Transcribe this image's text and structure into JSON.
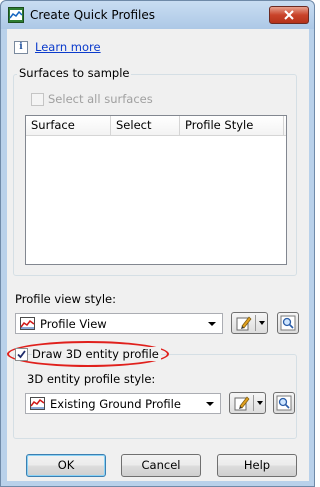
{
  "window": {
    "title": "Create Quick Profiles"
  },
  "help": {
    "learn_more": "Learn more"
  },
  "surfaces_group": {
    "label": "Surfaces to sample",
    "select_all_label": "Select all surfaces",
    "select_all_checked": false,
    "select_all_enabled": false,
    "columns": [
      "Surface",
      "Select",
      "Profile Style"
    ]
  },
  "profile_view": {
    "label": "Profile view style:",
    "selected": "Profile View",
    "icon": "profile-view-icon"
  },
  "entity_profile": {
    "draw_label": "Draw 3D entity profile",
    "draw_checked": true,
    "style_label": "3D entity profile style:",
    "selected": "Existing Ground Profile",
    "icon": "profile-style-icon",
    "highlight_color": "#e0201c"
  },
  "buttons": {
    "ok": "OK",
    "cancel": "Cancel",
    "help": "Help"
  }
}
